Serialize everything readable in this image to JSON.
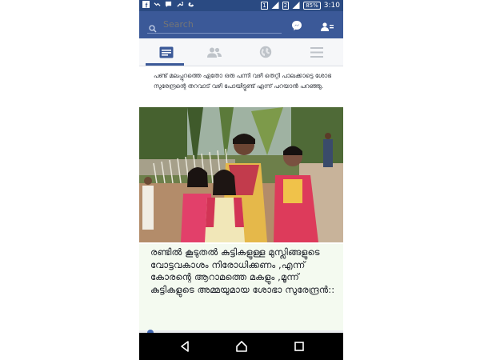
{
  "status_bar": {
    "left_icons": [
      "facebook-icon",
      "missed-call-icon",
      "message-icon",
      "wrench-icon",
      "voicemail-icon"
    ],
    "sim1": "1",
    "sim2": "2",
    "battery": "85%",
    "time": "3:10"
  },
  "search": {
    "placeholder": "Search"
  },
  "tabs": [
    {
      "name": "news-feed",
      "icon": "news-feed-icon",
      "active": true
    },
    {
      "name": "friends",
      "icon": "friends-icon",
      "active": false
    },
    {
      "name": "notifications",
      "icon": "globe-icon",
      "active": false
    },
    {
      "name": "more",
      "icon": "menu-icon",
      "active": false
    }
  ],
  "post": {
    "caption": "പണ്ട് മലപ്പുറത്തെ ഏതോ ഒരു പന്നി വഴി തെറ്റി പാലക്കാട്ടെ ശോഭ സുരേന്ദ്രന്റെ തറവാട് വഴി പോയിട്ടുണ്ട് എന്ന് പറയാൻ പറഞ്ഞു.",
    "meme_text": "രണ്ടിൽ കൂടുതൽ കുട്ടികളുള്ള മുസ്ലിങ്ങളുടെ വോട്ടവകാശം നിരോധിക്കണം ,എന്ന് കോരന്റെ ആറാമത്തെ മകളും ,മൂന്ന് കുട്ടികളുടെ അമ്മയുമായ ശോഭാ സുരേന്ദ്രൻ::"
  },
  "colors": {
    "brand": "#3b5998",
    "status": "#2a4a82",
    "meme_bg": "#f4faf0"
  },
  "nav": [
    "back-icon",
    "home-icon",
    "recent-apps-icon"
  ]
}
